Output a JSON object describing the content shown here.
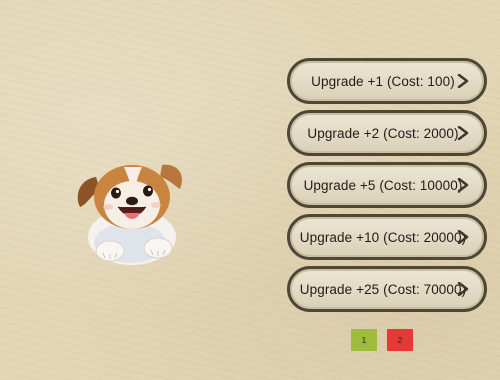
{
  "upgrades": [
    {
      "label": "Upgrade +1 (Cost: 100)"
    },
    {
      "label": "Upgrade +2 (Cost: 2000)"
    },
    {
      "label": "Upgrade +5 (Cost: 10000)"
    },
    {
      "label": "Upgrade +10 (Cost: 20000)"
    },
    {
      "label": "Upgrade +25 (Cost: 70000)"
    }
  ],
  "icons": {
    "character": "puppy-icon",
    "upgrade_arrow": "chevron-right-icon"
  },
  "pagination": {
    "page_1_label": "1",
    "page_2_label": "2",
    "page_1_color": "#9dbb3c",
    "page_2_color": "#e53935"
  },
  "colors": {
    "background": "#e3d6b6",
    "button_border": "#4e4738",
    "button_fill": "#e4dcc6"
  }
}
